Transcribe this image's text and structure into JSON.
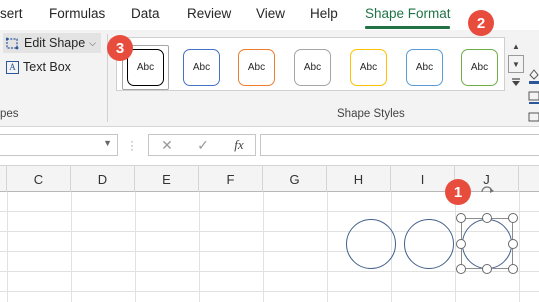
{
  "ribbon": {
    "tabs": [
      {
        "label": "sert",
        "active": false
      },
      {
        "label": "Formulas",
        "active": false
      },
      {
        "label": "Data",
        "active": false
      },
      {
        "label": "Review",
        "active": false
      },
      {
        "label": "View",
        "active": false
      },
      {
        "label": "Help",
        "active": false
      },
      {
        "label": "Shape Format",
        "active": true
      }
    ],
    "insert_shapes": {
      "edit_shape": "Edit Shape",
      "text_box": "Text Box",
      "group_label": "pes"
    },
    "shape_styles": {
      "group_label": "Shape Styles",
      "swatches": [
        {
          "label": "Abc",
          "border": "#000000",
          "selected": true
        },
        {
          "label": "Abc",
          "border": "#4472c4",
          "selected": false
        },
        {
          "label": "Abc",
          "border": "#ed7d31",
          "selected": false
        },
        {
          "label": "Abc",
          "border": "#a5a5a5",
          "selected": false
        },
        {
          "label": "Abc",
          "border": "#ffc000",
          "selected": false
        },
        {
          "label": "Abc",
          "border": "#5b9bd5",
          "selected": false
        },
        {
          "label": "Abc",
          "border": "#70ad47",
          "selected": false
        }
      ]
    }
  },
  "formula_bar": {
    "name_box_value": "",
    "cancel_icon": "✕",
    "enter_icon": "✓",
    "fx_label": "fx",
    "formula_value": ""
  },
  "grid": {
    "columns": [
      "C",
      "D",
      "E",
      "F",
      "G",
      "H",
      "I",
      "J"
    ]
  },
  "annotations": [
    {
      "number": "1"
    },
    {
      "number": "2"
    },
    {
      "number": "3"
    }
  ],
  "colors": {
    "accent": "#217346",
    "badge": "#e84c3d",
    "shape_outline": "#44628c"
  }
}
